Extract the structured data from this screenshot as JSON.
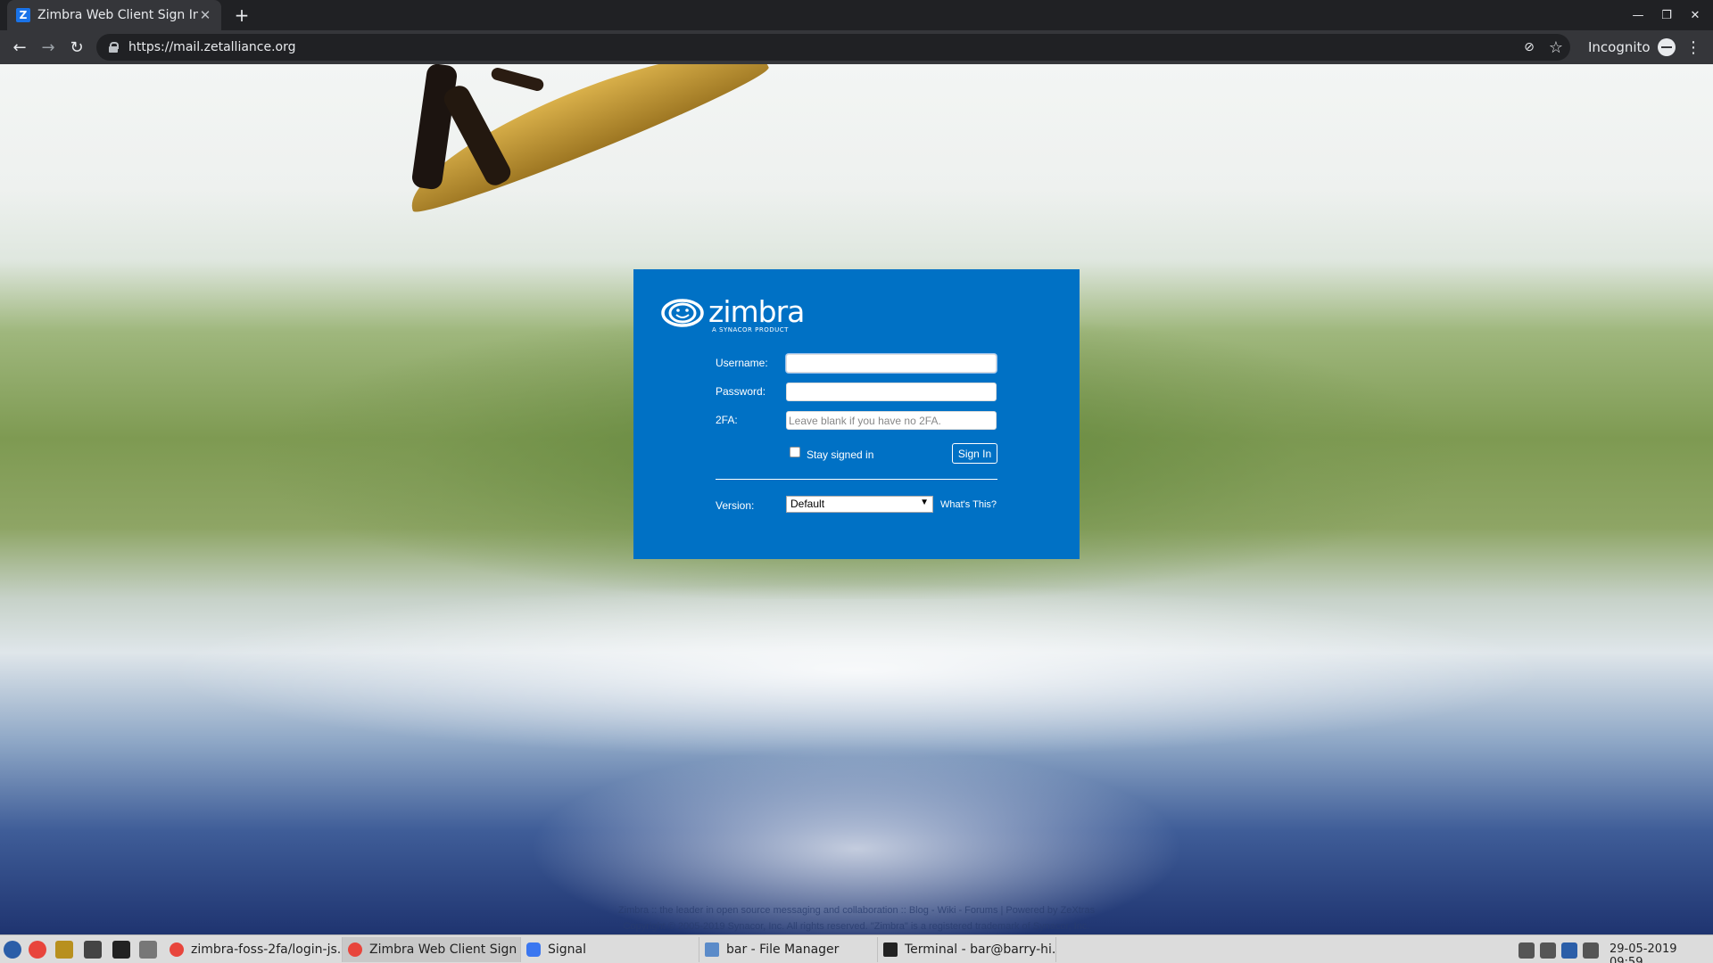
{
  "browser": {
    "tab_title": "Zimbra Web Client Sign In",
    "tab_favicon_letter": "Z",
    "url": "https://mail.zetalliance.org",
    "incognito_label": "Incognito"
  },
  "login": {
    "logo_word": "zimbra",
    "logo_sub": "A SYNACOR PRODUCT",
    "username_label": "Username:",
    "username_value": "",
    "password_label": "Password:",
    "password_value": "",
    "twofa_label": "2FA:",
    "twofa_placeholder": "Leave blank if you have no 2FA.",
    "stay_signed_in_label": "Stay signed in",
    "stay_signed_in_checked": false,
    "sign_in_label": "Sign In",
    "version_label": "Version:",
    "version_value": "Default",
    "whats_this_label": "What's This?"
  },
  "footer": {
    "line1": "Zimbra :: the leader in open source messaging and collaboration :: Blog - Wiki - Forums | Powered by ZeXtras",
    "line2": "Copyright © 2005-2019 Synacor, Inc. All rights reserved. \"Zimbra\" is a registered trademark of Synacor, Inc."
  },
  "taskbar": {
    "tasks": [
      {
        "label": "zimbra-foss-2fa/login-js..."
      },
      {
        "label": "Zimbra Web Client Sign ..."
      },
      {
        "label": "Signal"
      },
      {
        "label": "bar - File Manager"
      },
      {
        "label": "Terminal - bar@barry-hi..."
      }
    ],
    "clock": "29-05-2019 09:59"
  },
  "colors": {
    "login_bg": "#0071c5",
    "browser_dark": "#202124",
    "toolbar": "#35363a",
    "taskbar": "#dcdcdc"
  },
  "icons": {
    "back": "arrow-left-icon",
    "forward": "arrow-right-icon",
    "reload": "reload-icon",
    "lock": "lock-icon",
    "bookmark": "star-icon",
    "menu": "kebab-menu-icon"
  }
}
